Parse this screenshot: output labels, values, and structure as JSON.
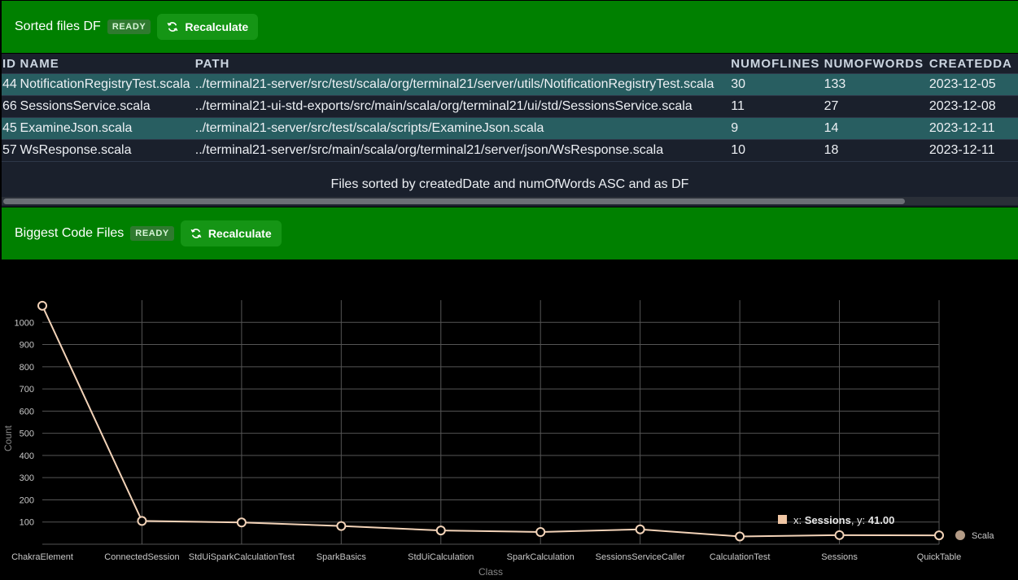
{
  "panel1": {
    "title": "Sorted files DF",
    "badge": "READY",
    "button_label": "Recalculate",
    "button_icon": "refresh-icon",
    "header_color": "#008000",
    "columns": [
      "ID",
      "NAME",
      "PATH",
      "NUMOFLINES",
      "NUMOFWORDS",
      "CREATEDDA"
    ],
    "rows": [
      [
        "44",
        "NotificationRegistryTest.scala",
        "../terminal21-server/src/test/scala/org/terminal21/server/utils/NotificationRegistryTest.scala",
        "30",
        "133",
        "2023-12-05"
      ],
      [
        "66",
        "SessionsService.scala",
        "../terminal21-ui-std-exports/src/main/scala/org/terminal21/ui/std/SessionsService.scala",
        "11",
        "27",
        "2023-12-08"
      ],
      [
        "45",
        "ExamineJson.scala",
        "../terminal21-server/src/test/scala/scripts/ExamineJson.scala",
        "9",
        "14",
        "2023-12-11"
      ],
      [
        "57",
        "WsResponse.scala",
        "../terminal21-server/src/main/scala/org/terminal21/server/json/WsResponse.scala",
        "10",
        "18",
        "2023-12-11"
      ]
    ],
    "caption": "Files sorted by createdDate and numOfWords ASC and as DF"
  },
  "panel2": {
    "title": "Biggest Code Files",
    "badge": "READY",
    "button_label": "Recalculate",
    "button_icon": "refresh-icon"
  },
  "chart_data": {
    "type": "line",
    "xlabel": "Class",
    "ylabel": "Count",
    "categories": [
      "ChakraElement",
      "ConnectedSession",
      "StdUiSparkCalculationTest",
      "SparkBasics",
      "StdUiCalculation",
      "SparkCalculation",
      "SessionsServiceCaller",
      "CalculationTest",
      "Sessions",
      "QuickTable"
    ],
    "series": [
      {
        "name": "Scala",
        "values": [
          1075,
          105,
          98,
          82,
          62,
          55,
          67,
          35,
          41,
          40
        ],
        "color": "#f3d3b8"
      }
    ],
    "yticks": [
      100,
      200,
      300,
      400,
      500,
      600,
      700,
      800,
      900,
      1000
    ],
    "ylim": [
      0,
      1100
    ],
    "grid": true,
    "legend": "right",
    "tooltip": {
      "x_label": "x:",
      "x_value": "Sessions",
      "y_label": "y:",
      "y_value": "41.00"
    }
  }
}
